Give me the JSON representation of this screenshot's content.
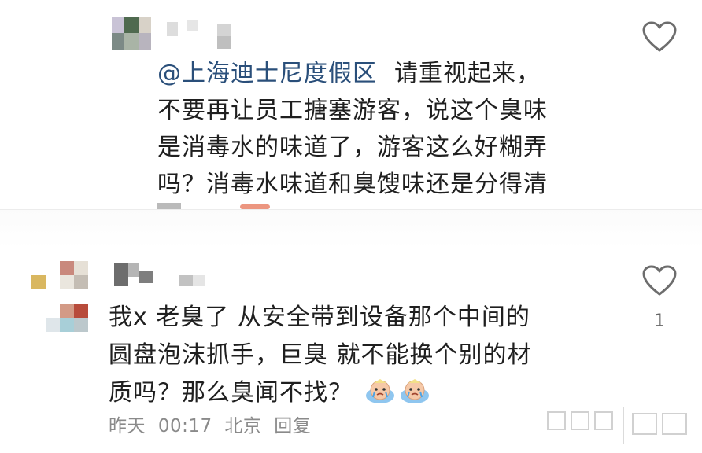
{
  "colors": {
    "mention": "#2a4f7a",
    "text": "#1f1f1f",
    "meta": "#8a8a8a",
    "icon": "#6d6d6d"
  },
  "comments": [
    {
      "mention": "@上海迪士尼度假区",
      "text_after_mention": "请重视起来，",
      "lines": [
        "不要再让员工搪塞游客，说这个臭味",
        "是消毒水的味道了，游客这么好糊弄",
        "吗？消毒水味道和臭馊味还是分得清"
      ],
      "like_icon": "heart-outline-icon"
    },
    {
      "lines": [
        "我x 老臭了 从安全带到设备那个中间的",
        "圆盘泡沫抓手，巨臭 就不能换个别的材"
      ],
      "last_line": "质吗？那么臭闻不找？",
      "emojis": [
        "crying-face-emoji",
        "crying-face-emoji"
      ],
      "like_icon": "heart-outline-icon",
      "like_count": "1",
      "meta": {
        "date": "昨天",
        "time": "00:17",
        "location": "北京",
        "reply_label": "回复"
      }
    }
  ]
}
